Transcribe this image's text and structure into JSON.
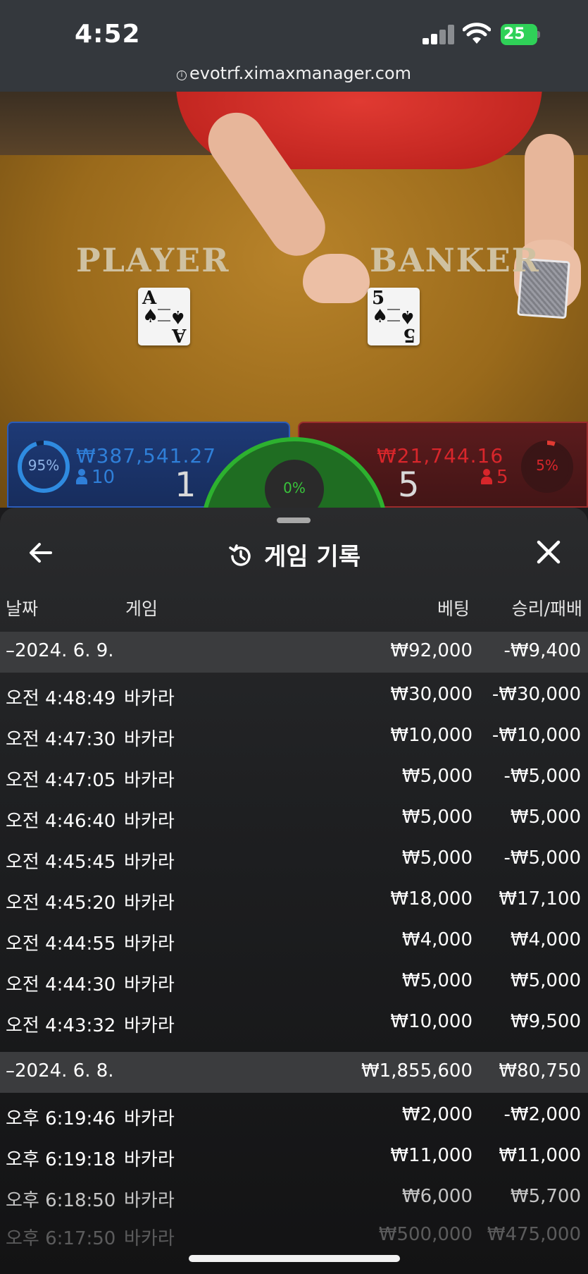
{
  "status_bar": {
    "time": "4:52",
    "battery": "25"
  },
  "browser": {
    "url": "evotrf.ximaxmanager.com"
  },
  "table": {
    "player_label": "PLAYER",
    "banker_label": "BANKER",
    "player_card": {
      "rank": "A",
      "suit": "♠"
    },
    "banker_card": {
      "rank": "5",
      "suit": "♠"
    }
  },
  "panels": {
    "player": {
      "percent": "95%",
      "amount": "₩387,541.27",
      "players": "10",
      "score": "1",
      "color": "#2f7fd8"
    },
    "banker": {
      "percent": "5%",
      "amount": "₩21,744.16",
      "players": "5",
      "score": "5",
      "color": "#d8262b"
    },
    "tie": {
      "percent": "0%",
      "color": "#39c43b"
    }
  },
  "sheet": {
    "title": "게임 기록",
    "columns": {
      "date": "날짜",
      "game": "게임",
      "bet": "베팅",
      "result": "승리/패배"
    },
    "groups": [
      {
        "date": "–2024. 6. 9.",
        "bet_total": "₩92,000",
        "result_total": "-₩9,400",
        "rows": [
          {
            "time": "오전 4:48:49",
            "game": "바카라",
            "bet": "₩30,000",
            "result": "-₩30,000"
          },
          {
            "time": "오전 4:47:30",
            "game": "바카라",
            "bet": "₩10,000",
            "result": "-₩10,000"
          },
          {
            "time": "오전 4:47:05",
            "game": "바카라",
            "bet": "₩5,000",
            "result": "-₩5,000"
          },
          {
            "time": "오전 4:46:40",
            "game": "바카라",
            "bet": "₩5,000",
            "result": "₩5,000"
          },
          {
            "time": "오전 4:45:45",
            "game": "바카라",
            "bet": "₩5,000",
            "result": "-₩5,000"
          },
          {
            "time": "오전 4:45:20",
            "game": "바카라",
            "bet": "₩18,000",
            "result": "₩17,100"
          },
          {
            "time": "오전 4:44:55",
            "game": "바카라",
            "bet": "₩4,000",
            "result": "₩4,000"
          },
          {
            "time": "오전 4:44:30",
            "game": "바카라",
            "bet": "₩5,000",
            "result": "₩5,000"
          },
          {
            "time": "오전 4:43:32",
            "game": "바카라",
            "bet": "₩10,000",
            "result": "₩9,500"
          }
        ]
      },
      {
        "date": "–2024. 6. 8.",
        "bet_total": "₩1,855,600",
        "result_total": "₩80,750",
        "rows": [
          {
            "time": "오후 6:19:46",
            "game": "바카라",
            "bet": "₩2,000",
            "result": "-₩2,000"
          },
          {
            "time": "오후 6:19:18",
            "game": "바카라",
            "bet": "₩11,000",
            "result": "₩11,000"
          },
          {
            "time": "오후 6:18:50",
            "game": "바카라",
            "bet": "₩6,000",
            "result": "₩5,700"
          },
          {
            "time": "오후 6:17:50",
            "game": "바카라",
            "bet": "₩500,000",
            "result": "₩475,000"
          }
        ]
      }
    ]
  }
}
